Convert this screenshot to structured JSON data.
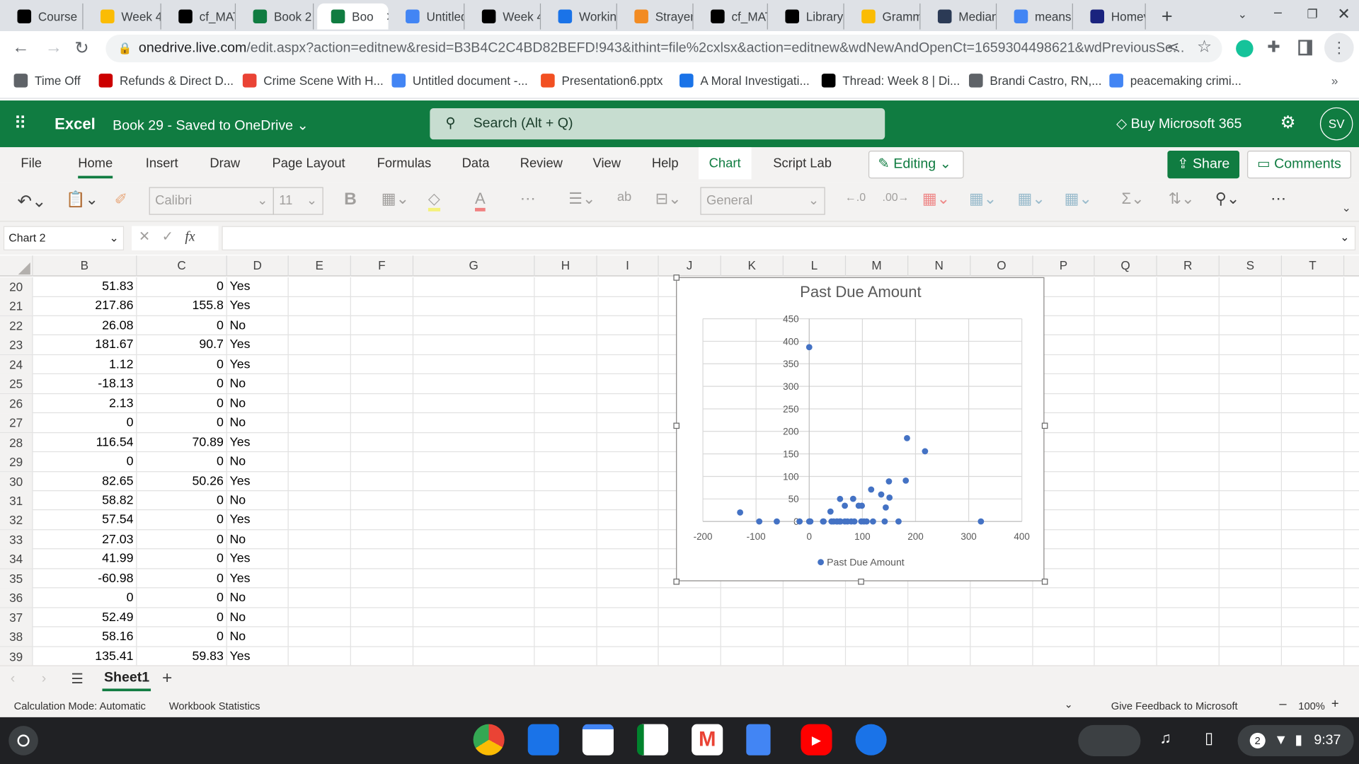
{
  "browser": {
    "tabs": [
      {
        "label": "Course",
        "icon": "blackboard-icon",
        "color": "#000000"
      },
      {
        "label": "Week 4",
        "icon": "pinwheel-icon",
        "color": "#fbbc04"
      },
      {
        "label": "cf_MAT",
        "icon": "blackboard-icon",
        "color": "#000000"
      },
      {
        "label": "Book 2",
        "icon": "excel-icon",
        "color": "#107c41"
      },
      {
        "label": "Boo",
        "icon": "excel-icon",
        "color": "#107c41",
        "active": true
      },
      {
        "label": "Untitled",
        "icon": "docs-icon",
        "color": "#4285f4"
      },
      {
        "label": "Week 4",
        "icon": "blackboard-icon",
        "color": "#000000"
      },
      {
        "label": "Workin",
        "icon": "video-icon",
        "color": "#1a73e8"
      },
      {
        "label": "Strayer",
        "icon": "bookmark-icon",
        "color": "#f28b22"
      },
      {
        "label": "cf_MAT",
        "icon": "blackboard-icon",
        "color": "#000000"
      },
      {
        "label": "Library",
        "icon": "blackboard-icon",
        "color": "#000000"
      },
      {
        "label": "Gramm",
        "icon": "grammarly-icon",
        "color": "#fbbc04"
      },
      {
        "label": "Median",
        "icon": "median-icon",
        "color": "#2b3a55"
      },
      {
        "label": "means",
        "icon": "google-icon",
        "color": "#4285f4"
      },
      {
        "label": "Homev",
        "icon": "shield-star-icon",
        "color": "#1a237e"
      }
    ],
    "url_host": "onedrive.live.com",
    "url_path": "/edit.aspx?action=editnew&resid=B3B4C2C4BD82BEFD!943&ithint=file%2cxlsx&action=editnew&wdNewAndOpenCt=1659304498621&wdPreviousSe...",
    "bookmarks": [
      "Time Off",
      "Refunds & Direct D...",
      "Crime Scene With H...",
      "Untitled document -...",
      "Presentation6.pptx",
      "A Moral Investigati...",
      "Thread: Week 8 | Di...",
      "Brandi Castro, RN,...",
      "peacemaking crimi..."
    ],
    "bookmarks_more": "»"
  },
  "excel": {
    "app_name": "Excel",
    "doc_title": "Book 29  -  Saved to OneDrive",
    "search_placeholder": "Search (Alt + Q)",
    "buy": "Buy Microsoft 365",
    "avatar": "SV",
    "ribbon_tabs": [
      "File",
      "Home",
      "Insert",
      "Draw",
      "Page Layout",
      "Formulas",
      "Data",
      "Review",
      "View",
      "Help",
      "Chart",
      "Script Lab"
    ],
    "active_tab": "Home",
    "editing": "Editing",
    "share": "Share",
    "comments": "Comments",
    "font": "Calibri",
    "font_size": "11",
    "number_format": "General",
    "name_box": "Chart 2",
    "fx": "fx",
    "columns": [
      "B",
      "C",
      "D",
      "E",
      "F",
      "G",
      "H",
      "I",
      "J",
      "K",
      "L",
      "M",
      "N",
      "O",
      "P",
      "Q",
      "R",
      "S",
      "T"
    ],
    "rows": [
      {
        "n": "20",
        "b": "51.83",
        "c": "0",
        "d": "Yes"
      },
      {
        "n": "21",
        "b": "217.86",
        "c": "155.8",
        "d": "Yes"
      },
      {
        "n": "22",
        "b": "26.08",
        "c": "0",
        "d": "No"
      },
      {
        "n": "23",
        "b": "181.67",
        "c": "90.7",
        "d": "Yes"
      },
      {
        "n": "24",
        "b": "1.12",
        "c": "0",
        "d": "Yes"
      },
      {
        "n": "25",
        "b": "-18.13",
        "c": "0",
        "d": "No"
      },
      {
        "n": "26",
        "b": "2.13",
        "c": "0",
        "d": "No"
      },
      {
        "n": "27",
        "b": "0",
        "c": "0",
        "d": "No"
      },
      {
        "n": "28",
        "b": "116.54",
        "c": "70.89",
        "d": "Yes"
      },
      {
        "n": "29",
        "b": "0",
        "c": "0",
        "d": "No"
      },
      {
        "n": "30",
        "b": "82.65",
        "c": "50.26",
        "d": "Yes"
      },
      {
        "n": "31",
        "b": "58.82",
        "c": "0",
        "d": "No"
      },
      {
        "n": "32",
        "b": "57.54",
        "c": "0",
        "d": "Yes"
      },
      {
        "n": "33",
        "b": "27.03",
        "c": "0",
        "d": "No"
      },
      {
        "n": "34",
        "b": "41.99",
        "c": "0",
        "d": "Yes"
      },
      {
        "n": "35",
        "b": "-60.98",
        "c": "0",
        "d": "Yes"
      },
      {
        "n": "36",
        "b": "0",
        "c": "0",
        "d": "No"
      },
      {
        "n": "37",
        "b": "52.49",
        "c": "0",
        "d": "No"
      },
      {
        "n": "38",
        "b": "58.16",
        "c": "0",
        "d": "No"
      },
      {
        "n": "39",
        "b": "135.41",
        "c": "59.83",
        "d": "Yes"
      }
    ],
    "sheet": "Sheet1",
    "status_left": "Calculation Mode: Automatic",
    "status_stats": "Workbook Statistics",
    "feedback": "Give Feedback to Microsoft",
    "zoom": "100%"
  },
  "shelf": {
    "time": "9:37",
    "notifications": "2",
    "apps": [
      "chrome",
      "files",
      "calendar",
      "meet",
      "gmail",
      "docs",
      "youtube",
      "messages"
    ]
  },
  "chart_data": {
    "type": "scatter",
    "title": "Past Due Amount",
    "xlim": [
      -200,
      400
    ],
    "ylim": [
      0,
      450
    ],
    "xticks": [
      -200,
      -100,
      0,
      100,
      200,
      300,
      400
    ],
    "yticks": [
      0,
      50,
      100,
      150,
      200,
      250,
      300,
      350,
      400,
      450
    ],
    "grid": true,
    "legend": "bottom",
    "series": [
      {
        "name": "Past Due Amount",
        "color": "#4472c4",
        "points": [
          [
            -130,
            20
          ],
          [
            0,
            387
          ],
          [
            184,
            185
          ],
          [
            217.86,
            155.8
          ],
          [
            150,
            89
          ],
          [
            181.67,
            90.7
          ],
          [
            116.54,
            70.89
          ],
          [
            135.41,
            59.83
          ],
          [
            151,
            53
          ],
          [
            58,
            50
          ],
          [
            82.65,
            50.26
          ],
          [
            67,
            35
          ],
          [
            93,
            35
          ],
          [
            99,
            35
          ],
          [
            144,
            31
          ],
          [
            40,
            22
          ],
          [
            -94,
            0
          ],
          [
            -60.98,
            0
          ],
          [
            -18.13,
            0
          ],
          [
            0,
            0
          ],
          [
            1.12,
            0
          ],
          [
            2.13,
            0
          ],
          [
            26.08,
            0
          ],
          [
            27.03,
            0
          ],
          [
            41.99,
            0
          ],
          [
            46,
            0
          ],
          [
            51.83,
            0
          ],
          [
            52.49,
            0
          ],
          [
            57.54,
            0
          ],
          [
            58.16,
            0
          ],
          [
            58.82,
            0
          ],
          [
            67,
            0
          ],
          [
            72,
            0
          ],
          [
            79,
            0
          ],
          [
            85,
            0
          ],
          [
            98,
            0
          ],
          [
            103,
            0
          ],
          [
            108,
            0
          ],
          [
            120,
            0
          ],
          [
            142,
            0
          ],
          [
            168,
            0
          ],
          [
            323,
            0
          ]
        ]
      }
    ]
  }
}
